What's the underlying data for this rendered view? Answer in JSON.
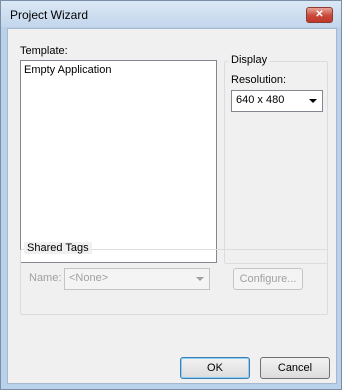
{
  "window": {
    "title": "Project Wizard"
  },
  "template": {
    "label": "Template:",
    "items": [
      "Empty Application"
    ]
  },
  "display": {
    "group_label": "Display",
    "resolution_label": "Resolution:",
    "resolution_value": "640 x 480"
  },
  "shared_tags": {
    "group_label": "Shared Tags",
    "name_label": "Name:",
    "name_value": "<None>",
    "configure_label": "Configure..."
  },
  "buttons": {
    "ok": "OK",
    "cancel": "Cancel"
  },
  "icons": {
    "close": "close-icon",
    "combo_arrow": "chevron-down-icon"
  }
}
